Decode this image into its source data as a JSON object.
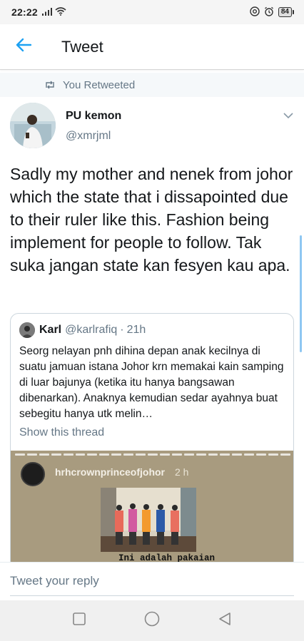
{
  "status_bar": {
    "time": "22:22",
    "battery": "84",
    "icons": [
      "signal-icon",
      "wifi-icon",
      "at-icon",
      "alarm-icon",
      "battery-icon"
    ]
  },
  "header": {
    "title": "Tweet",
    "back_icon": "back-arrow-icon",
    "accent_color": "#1da1f2"
  },
  "retweet": {
    "label": "You Retweeted",
    "icon": "retweet-icon"
  },
  "tweet": {
    "author_name": "PU kemon",
    "author_handle": "@xmrjml",
    "text": "Sadly my mother and nenek from johor which the state that i dissapointed due to their ruler like this. Fashion being implement for people to follow. Tak suka jangan state kan fesyen kau apa."
  },
  "quote": {
    "name": "Karl",
    "handle": "@karlrafiq",
    "separator": "·",
    "time": "21h",
    "text": "Seorg nelayan pnh dihina depan anak kecilnya di suatu jamuan istana Johor krn memakai kain samping di luar bajunya (ketika itu hanya bangsawan dibenarkan). Anaknya kemudian sedar ayahnya buat sebegitu hanya utk melin…",
    "show_thread": "Show this thread",
    "image": {
      "username": "hrhcrownprinceofjohor",
      "time": "2 h",
      "caption": "Ini adalah pakaian"
    }
  },
  "reply": {
    "placeholder": "Tweet your reply"
  },
  "nav": {
    "items": [
      "square-icon",
      "circle-icon",
      "triangle-back-icon"
    ]
  },
  "colors": {
    "secondary_text": "#657786",
    "primary_text": "#14171a",
    "border": "#ccd6dd"
  }
}
